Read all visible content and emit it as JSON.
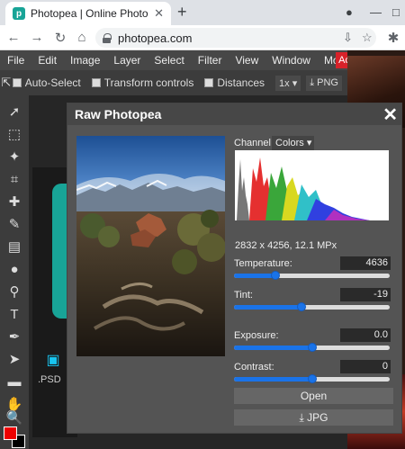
{
  "browser": {
    "tab_title": "Photopea | Online Photo Editor",
    "tab_favicon_letter": "p",
    "url": "photopea.com"
  },
  "menu": {
    "items": [
      "File",
      "Edit",
      "Image",
      "Layer",
      "Select",
      "Filter",
      "View",
      "Window",
      "More"
    ],
    "ad_label": "Ac"
  },
  "options": {
    "auto_select": "Auto-Select",
    "transform_controls": "Transform controls",
    "distances": "Distances",
    "zoom": "1x",
    "export": "PNG"
  },
  "workspace": {
    "psd_label": ".PSD"
  },
  "dialog": {
    "title": "Raw Photopea",
    "channel_label": "Channel:",
    "channel_value": "Colors",
    "image_info": "2832 x 4256, 12.1 MPx",
    "sliders": [
      {
        "label": "Temperature:",
        "value": "4636",
        "level": 0.25
      },
      {
        "label": "Tint:",
        "value": "-19",
        "level": 0.43
      },
      {
        "label": "Exposure:",
        "value": "0.0",
        "level": 0.5
      },
      {
        "label": "Contrast:",
        "value": "0",
        "level": 0.5
      }
    ],
    "open_button": "Open",
    "export_button": "JPG"
  },
  "colors": {
    "accent": "#1a73e8",
    "foreground": "#ee0000",
    "background": "#000000"
  }
}
